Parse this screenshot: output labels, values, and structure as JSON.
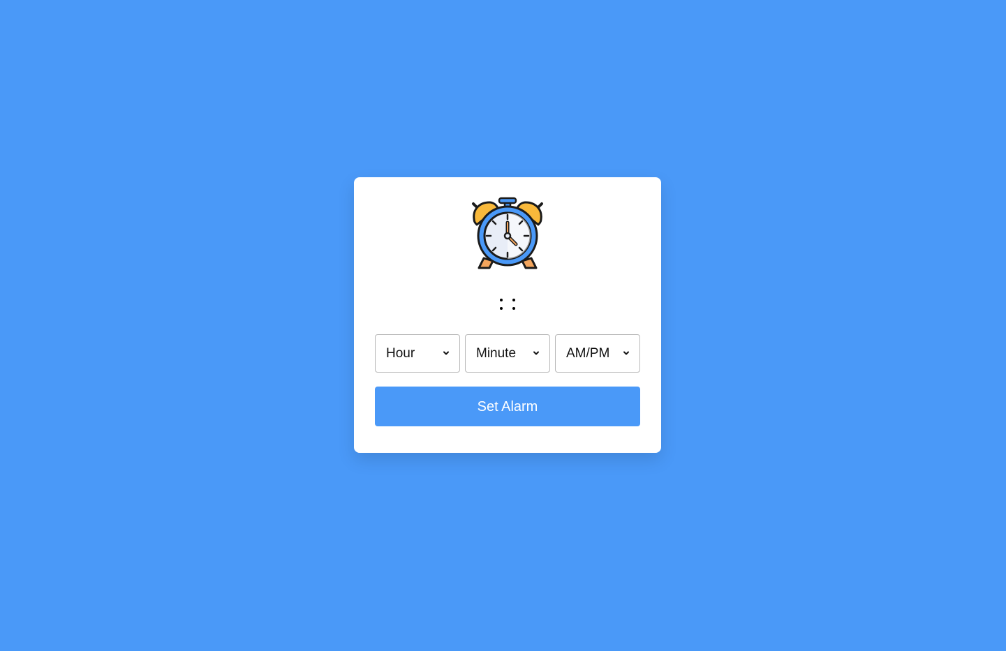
{
  "app": {
    "background_color": "#4a99f8",
    "card_color": "#ffffff",
    "accent_color": "#4a99f8"
  },
  "clock_icon": {
    "name": "alarm-clock-icon",
    "colors": {
      "bells": "#f9b93b",
      "ring": "#4a99f8",
      "face": "#e8edf7",
      "legs": "#f3a55d",
      "outline": "#1b1b1b"
    }
  },
  "time_display": {
    "hours": "",
    "minutes": "",
    "seconds": ""
  },
  "selects": {
    "hour": {
      "selected": "Hour",
      "icon": "chevron-down-icon"
    },
    "minute": {
      "selected": "Minute",
      "icon": "chevron-down-icon"
    },
    "ampm": {
      "selected": "AM/PM",
      "icon": "chevron-down-icon"
    }
  },
  "actions": {
    "set_alarm_label": "Set Alarm"
  }
}
